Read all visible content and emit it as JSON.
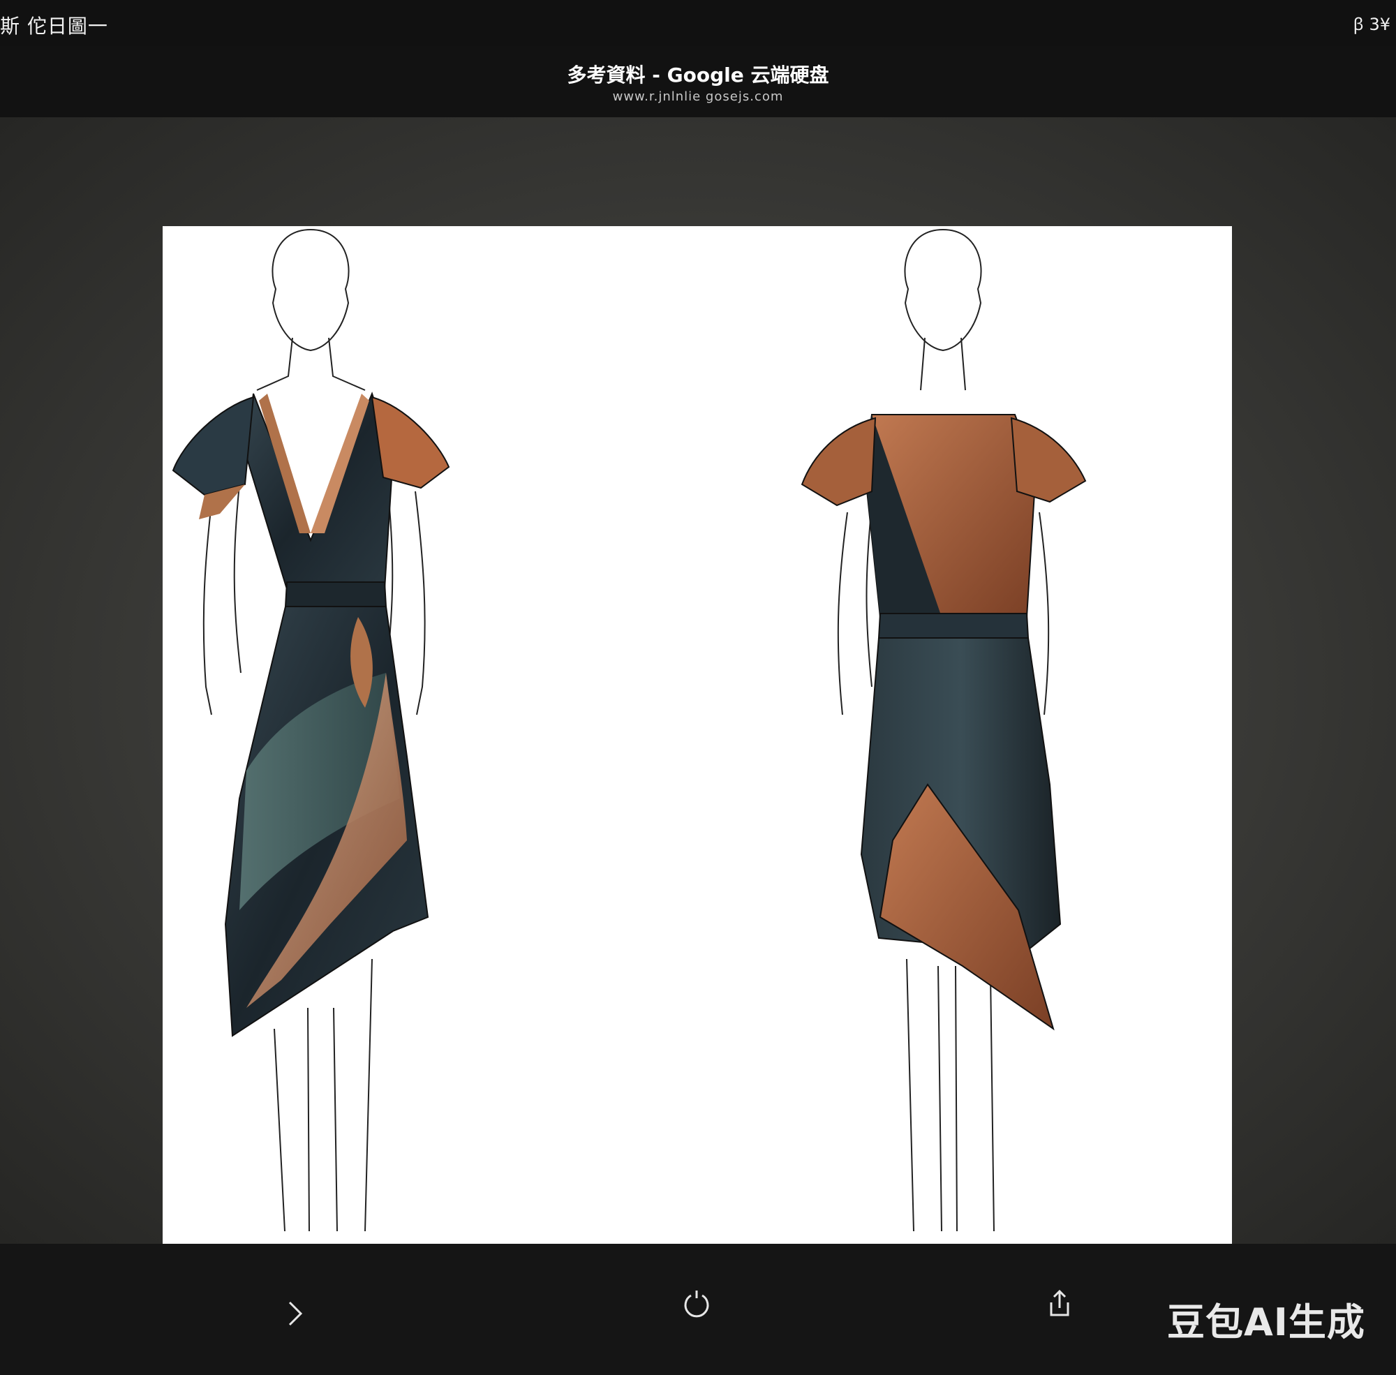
{
  "status_bar": {
    "left_text": "斯 佗日圖一",
    "right_text": "ꞵ 3¥"
  },
  "header": {
    "title": "多考資料 - Google 云端硬盘",
    "url": "www.r.jnlnlie gosejs.com"
  },
  "image": {
    "figures": [
      {
        "view": "front",
        "dress_colors": [
          "#1f2b33",
          "#3e5a5c",
          "#b0724a",
          "#d9a27f"
        ]
      },
      {
        "view": "back",
        "dress_colors": [
          "#1b2429",
          "#8a4a2e",
          "#b56a44"
        ]
      }
    ]
  },
  "bottom_bar": {
    "icons": [
      "chevron-right-icon",
      "rotate-icon",
      "share-icon"
    ]
  },
  "watermark": "豆包AI生成"
}
